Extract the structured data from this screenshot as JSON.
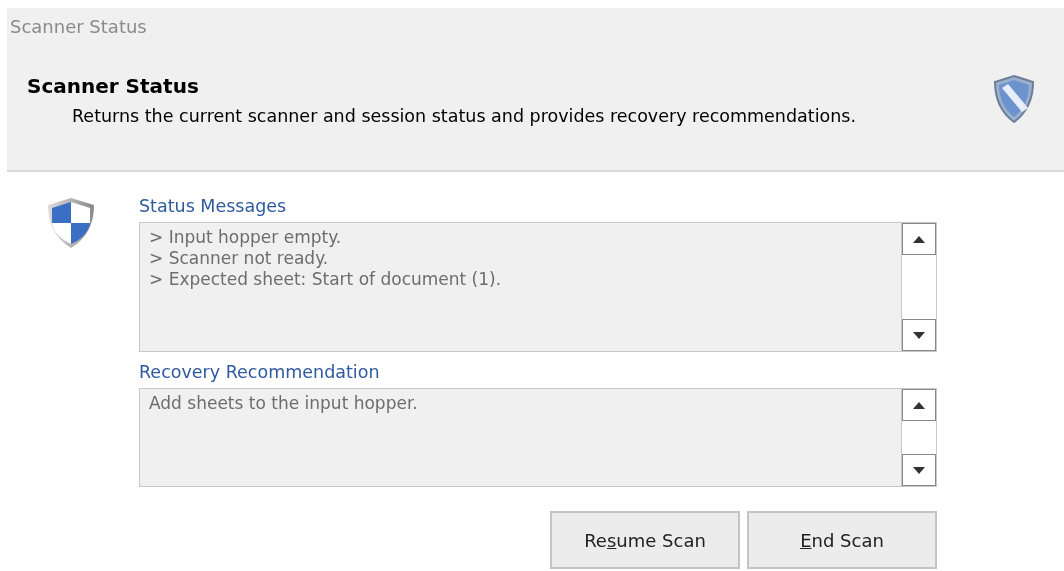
{
  "window": {
    "title": "Scanner Status"
  },
  "header": {
    "title": "Scanner Status",
    "description": "Returns the current scanner and session status and provides recovery recommendations."
  },
  "sections": [
    {
      "label": "Status Messages",
      "lines": [
        "> Input hopper empty.",
        "> Scanner not ready.",
        "> Expected sheet: Start of document (1)."
      ]
    },
    {
      "label": "Recovery Recommendation",
      "lines": [
        "Add sheets to the input hopper."
      ]
    }
  ],
  "buttons": [
    {
      "before": "Re",
      "key": "s",
      "after": "ume Scan"
    },
    {
      "key": "E",
      "after": "nd Scan"
    }
  ]
}
